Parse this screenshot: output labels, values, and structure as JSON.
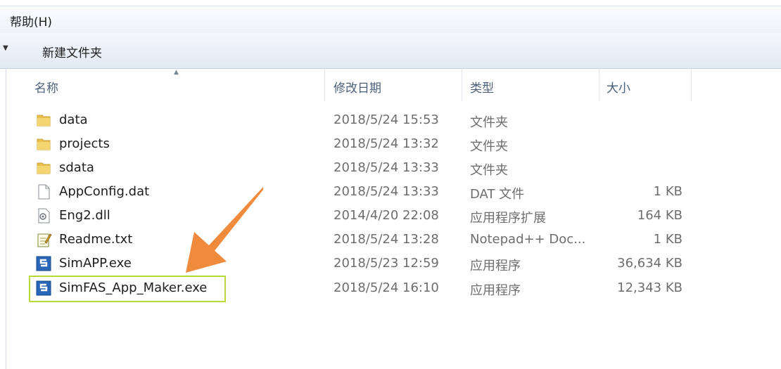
{
  "menubar": {
    "help_label": "帮助(H)"
  },
  "toolbar": {
    "new_folder_label": "新建文件夹"
  },
  "columns": {
    "name": "名称",
    "date": "修改日期",
    "type": "类型",
    "size": "大小"
  },
  "files": [
    {
      "name": "data",
      "date": "2018/5/24 15:53",
      "type": "文件夹",
      "size": "",
      "icon": "folder-icon"
    },
    {
      "name": "projects",
      "date": "2018/5/24 13:32",
      "type": "文件夹",
      "size": "",
      "icon": "folder-icon"
    },
    {
      "name": "sdata",
      "date": "2018/5/24 13:33",
      "type": "文件夹",
      "size": "",
      "icon": "folder-icon"
    },
    {
      "name": "AppConfig.dat",
      "date": "2018/5/24 13:33",
      "type": "DAT 文件",
      "size": "1 KB",
      "icon": "file-icon"
    },
    {
      "name": "Eng2.dll",
      "date": "2014/4/20 22:08",
      "type": "应用程序扩展",
      "size": "164 KB",
      "icon": "dll-icon"
    },
    {
      "name": "Readme.txt",
      "date": "2018/5/24 13:28",
      "type": "Notepad++ Doc...",
      "size": "1 KB",
      "icon": "notepad-icon"
    },
    {
      "name": "SimAPP.exe",
      "date": "2018/5/23 12:59",
      "type": "应用程序",
      "size": "36,634 KB",
      "icon": "app-icon"
    },
    {
      "name": "SimFAS_App_Maker.exe",
      "date": "2018/5/24 16:10",
      "type": "应用程序",
      "size": "12,343 KB",
      "icon": "app-icon"
    }
  ],
  "colors": {
    "highlight_border": "#b8d93a",
    "annotation_arrow": "#f08a3c",
    "folder": "#e8c04e",
    "app_icon": "#2a66b8"
  }
}
